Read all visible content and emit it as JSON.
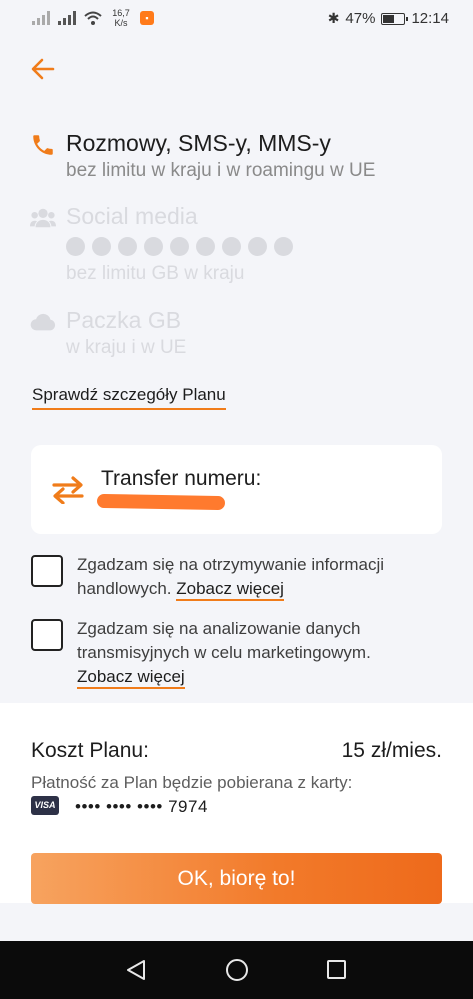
{
  "status_bar": {
    "network_speed": "16,7",
    "network_speed_unit": "K/s",
    "battery": "47%",
    "time": "12:14"
  },
  "features": [
    {
      "title": "Rozmowy, SMS-y, MMS-y",
      "subtitle": "bez limitu w kraju i w roamingu w UE",
      "icon": "phone-icon"
    },
    {
      "title": "Social media",
      "subtitle": "bez limitu GB w kraju",
      "icon": "users-icon",
      "social_icons": [
        "facebook-icon",
        "instagram-icon",
        "snapchat-icon",
        "tiktok-icon",
        "twitter-icon",
        "pinterest-icon",
        "viber-icon",
        "whatsapp-icon",
        "messenger-icon"
      ]
    },
    {
      "title": "Paczka GB",
      "subtitle": "w kraju i w UE",
      "icon": "cloud-icon"
    }
  ],
  "details_link": "Sprawdź szczegóły Planu",
  "transfer": {
    "label": "Transfer numeru:",
    "icon": "transfer-arrows-icon"
  },
  "consents": [
    {
      "text": "Zgadzam się na otrzymywanie informacji handlowych. ",
      "link": "Zobacz więcej",
      "checked": false
    },
    {
      "text": "Zgadzam się na analizowanie danych transmisyjnych w celu marketingowym. ",
      "link": "Zobacz więcej",
      "checked": false
    }
  ],
  "plan": {
    "cost_label": "Koszt Planu:",
    "cost_value": "15 zł/mies.",
    "payment_note": "Płatność za Plan będzie pobierana z karty:",
    "card_brand": "VISA",
    "card_number": "•••• •••• •••• 7974"
  },
  "cta_label": "OK, biorę to!",
  "colors": {
    "accent": "#f07c1a",
    "background": "#f4f5f9",
    "disabled": "#d9dadf"
  }
}
